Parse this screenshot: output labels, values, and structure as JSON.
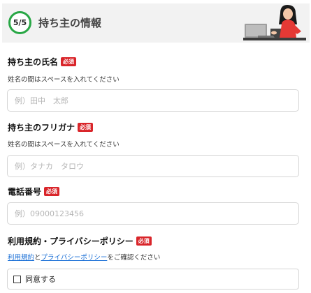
{
  "header": {
    "step": "5/5",
    "title": "持ち主の情報"
  },
  "fields": {
    "owner_name": {
      "label": "持ち主の氏名",
      "required": "必須",
      "help": "姓名の間はスペースを入れてください",
      "placeholder": "例）田中　太郎",
      "value": ""
    },
    "owner_kana": {
      "label": "持ち主のフリガナ",
      "required": "必須",
      "help": "姓名の間はスペースを入れてください",
      "placeholder": "例）タナカ　タロウ",
      "value": ""
    },
    "phone": {
      "label": "電話番号",
      "required": "必須",
      "placeholder": "例）09000123456",
      "value": ""
    }
  },
  "terms": {
    "label": "利用規約・プライバシーポリシー",
    "required": "必須",
    "terms_link": "利用規約",
    "and": "と",
    "privacy_link": "プライバシーポリシー",
    "suffix": "をご確認ください",
    "agree_label": "同意する",
    "agree_checked": false
  },
  "colors": {
    "step_ring": "#28a745",
    "required_badge": "#d9252a",
    "link": "#1a6fd6",
    "header_bg": "#f2f2f2"
  },
  "icons": [
    "woman-with-laptop-illustration",
    "checkbox"
  ]
}
